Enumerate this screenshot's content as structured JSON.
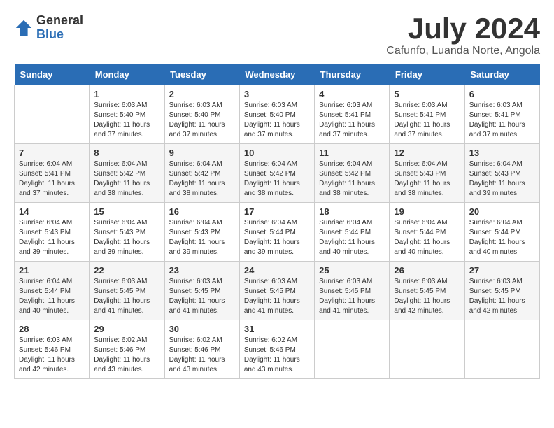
{
  "logo": {
    "general": "General",
    "blue": "Blue"
  },
  "header": {
    "month": "July 2024",
    "location": "Cafunfo, Luanda Norte, Angola"
  },
  "weekdays": [
    "Sunday",
    "Monday",
    "Tuesday",
    "Wednesday",
    "Thursday",
    "Friday",
    "Saturday"
  ],
  "weeks": [
    [
      {
        "day": "",
        "sunrise": "",
        "sunset": "",
        "daylight": ""
      },
      {
        "day": "1",
        "sunrise": "Sunrise: 6:03 AM",
        "sunset": "Sunset: 5:40 PM",
        "daylight": "Daylight: 11 hours and 37 minutes."
      },
      {
        "day": "2",
        "sunrise": "Sunrise: 6:03 AM",
        "sunset": "Sunset: 5:40 PM",
        "daylight": "Daylight: 11 hours and 37 minutes."
      },
      {
        "day": "3",
        "sunrise": "Sunrise: 6:03 AM",
        "sunset": "Sunset: 5:40 PM",
        "daylight": "Daylight: 11 hours and 37 minutes."
      },
      {
        "day": "4",
        "sunrise": "Sunrise: 6:03 AM",
        "sunset": "Sunset: 5:41 PM",
        "daylight": "Daylight: 11 hours and 37 minutes."
      },
      {
        "day": "5",
        "sunrise": "Sunrise: 6:03 AM",
        "sunset": "Sunset: 5:41 PM",
        "daylight": "Daylight: 11 hours and 37 minutes."
      },
      {
        "day": "6",
        "sunrise": "Sunrise: 6:03 AM",
        "sunset": "Sunset: 5:41 PM",
        "daylight": "Daylight: 11 hours and 37 minutes."
      }
    ],
    [
      {
        "day": "7",
        "sunrise": "Sunrise: 6:04 AM",
        "sunset": "Sunset: 5:41 PM",
        "daylight": "Daylight: 11 hours and 37 minutes."
      },
      {
        "day": "8",
        "sunrise": "Sunrise: 6:04 AM",
        "sunset": "Sunset: 5:42 PM",
        "daylight": "Daylight: 11 hours and 38 minutes."
      },
      {
        "day": "9",
        "sunrise": "Sunrise: 6:04 AM",
        "sunset": "Sunset: 5:42 PM",
        "daylight": "Daylight: 11 hours and 38 minutes."
      },
      {
        "day": "10",
        "sunrise": "Sunrise: 6:04 AM",
        "sunset": "Sunset: 5:42 PM",
        "daylight": "Daylight: 11 hours and 38 minutes."
      },
      {
        "day": "11",
        "sunrise": "Sunrise: 6:04 AM",
        "sunset": "Sunset: 5:42 PM",
        "daylight": "Daylight: 11 hours and 38 minutes."
      },
      {
        "day": "12",
        "sunrise": "Sunrise: 6:04 AM",
        "sunset": "Sunset: 5:43 PM",
        "daylight": "Daylight: 11 hours and 38 minutes."
      },
      {
        "day": "13",
        "sunrise": "Sunrise: 6:04 AM",
        "sunset": "Sunset: 5:43 PM",
        "daylight": "Daylight: 11 hours and 39 minutes."
      }
    ],
    [
      {
        "day": "14",
        "sunrise": "Sunrise: 6:04 AM",
        "sunset": "Sunset: 5:43 PM",
        "daylight": "Daylight: 11 hours and 39 minutes."
      },
      {
        "day": "15",
        "sunrise": "Sunrise: 6:04 AM",
        "sunset": "Sunset: 5:43 PM",
        "daylight": "Daylight: 11 hours and 39 minutes."
      },
      {
        "day": "16",
        "sunrise": "Sunrise: 6:04 AM",
        "sunset": "Sunset: 5:43 PM",
        "daylight": "Daylight: 11 hours and 39 minutes."
      },
      {
        "day": "17",
        "sunrise": "Sunrise: 6:04 AM",
        "sunset": "Sunset: 5:44 PM",
        "daylight": "Daylight: 11 hours and 39 minutes."
      },
      {
        "day": "18",
        "sunrise": "Sunrise: 6:04 AM",
        "sunset": "Sunset: 5:44 PM",
        "daylight": "Daylight: 11 hours and 40 minutes."
      },
      {
        "day": "19",
        "sunrise": "Sunrise: 6:04 AM",
        "sunset": "Sunset: 5:44 PM",
        "daylight": "Daylight: 11 hours and 40 minutes."
      },
      {
        "day": "20",
        "sunrise": "Sunrise: 6:04 AM",
        "sunset": "Sunset: 5:44 PM",
        "daylight": "Daylight: 11 hours and 40 minutes."
      }
    ],
    [
      {
        "day": "21",
        "sunrise": "Sunrise: 6:04 AM",
        "sunset": "Sunset: 5:44 PM",
        "daylight": "Daylight: 11 hours and 40 minutes."
      },
      {
        "day": "22",
        "sunrise": "Sunrise: 6:03 AM",
        "sunset": "Sunset: 5:45 PM",
        "daylight": "Daylight: 11 hours and 41 minutes."
      },
      {
        "day": "23",
        "sunrise": "Sunrise: 6:03 AM",
        "sunset": "Sunset: 5:45 PM",
        "daylight": "Daylight: 11 hours and 41 minutes."
      },
      {
        "day": "24",
        "sunrise": "Sunrise: 6:03 AM",
        "sunset": "Sunset: 5:45 PM",
        "daylight": "Daylight: 11 hours and 41 minutes."
      },
      {
        "day": "25",
        "sunrise": "Sunrise: 6:03 AM",
        "sunset": "Sunset: 5:45 PM",
        "daylight": "Daylight: 11 hours and 41 minutes."
      },
      {
        "day": "26",
        "sunrise": "Sunrise: 6:03 AM",
        "sunset": "Sunset: 5:45 PM",
        "daylight": "Daylight: 11 hours and 42 minutes."
      },
      {
        "day": "27",
        "sunrise": "Sunrise: 6:03 AM",
        "sunset": "Sunset: 5:45 PM",
        "daylight": "Daylight: 11 hours and 42 minutes."
      }
    ],
    [
      {
        "day": "28",
        "sunrise": "Sunrise: 6:03 AM",
        "sunset": "Sunset: 5:46 PM",
        "daylight": "Daylight: 11 hours and 42 minutes."
      },
      {
        "day": "29",
        "sunrise": "Sunrise: 6:02 AM",
        "sunset": "Sunset: 5:46 PM",
        "daylight": "Daylight: 11 hours and 43 minutes."
      },
      {
        "day": "30",
        "sunrise": "Sunrise: 6:02 AM",
        "sunset": "Sunset: 5:46 PM",
        "daylight": "Daylight: 11 hours and 43 minutes."
      },
      {
        "day": "31",
        "sunrise": "Sunrise: 6:02 AM",
        "sunset": "Sunset: 5:46 PM",
        "daylight": "Daylight: 11 hours and 43 minutes."
      },
      {
        "day": "",
        "sunrise": "",
        "sunset": "",
        "daylight": ""
      },
      {
        "day": "",
        "sunrise": "",
        "sunset": "",
        "daylight": ""
      },
      {
        "day": "",
        "sunrise": "",
        "sunset": "",
        "daylight": ""
      }
    ]
  ]
}
